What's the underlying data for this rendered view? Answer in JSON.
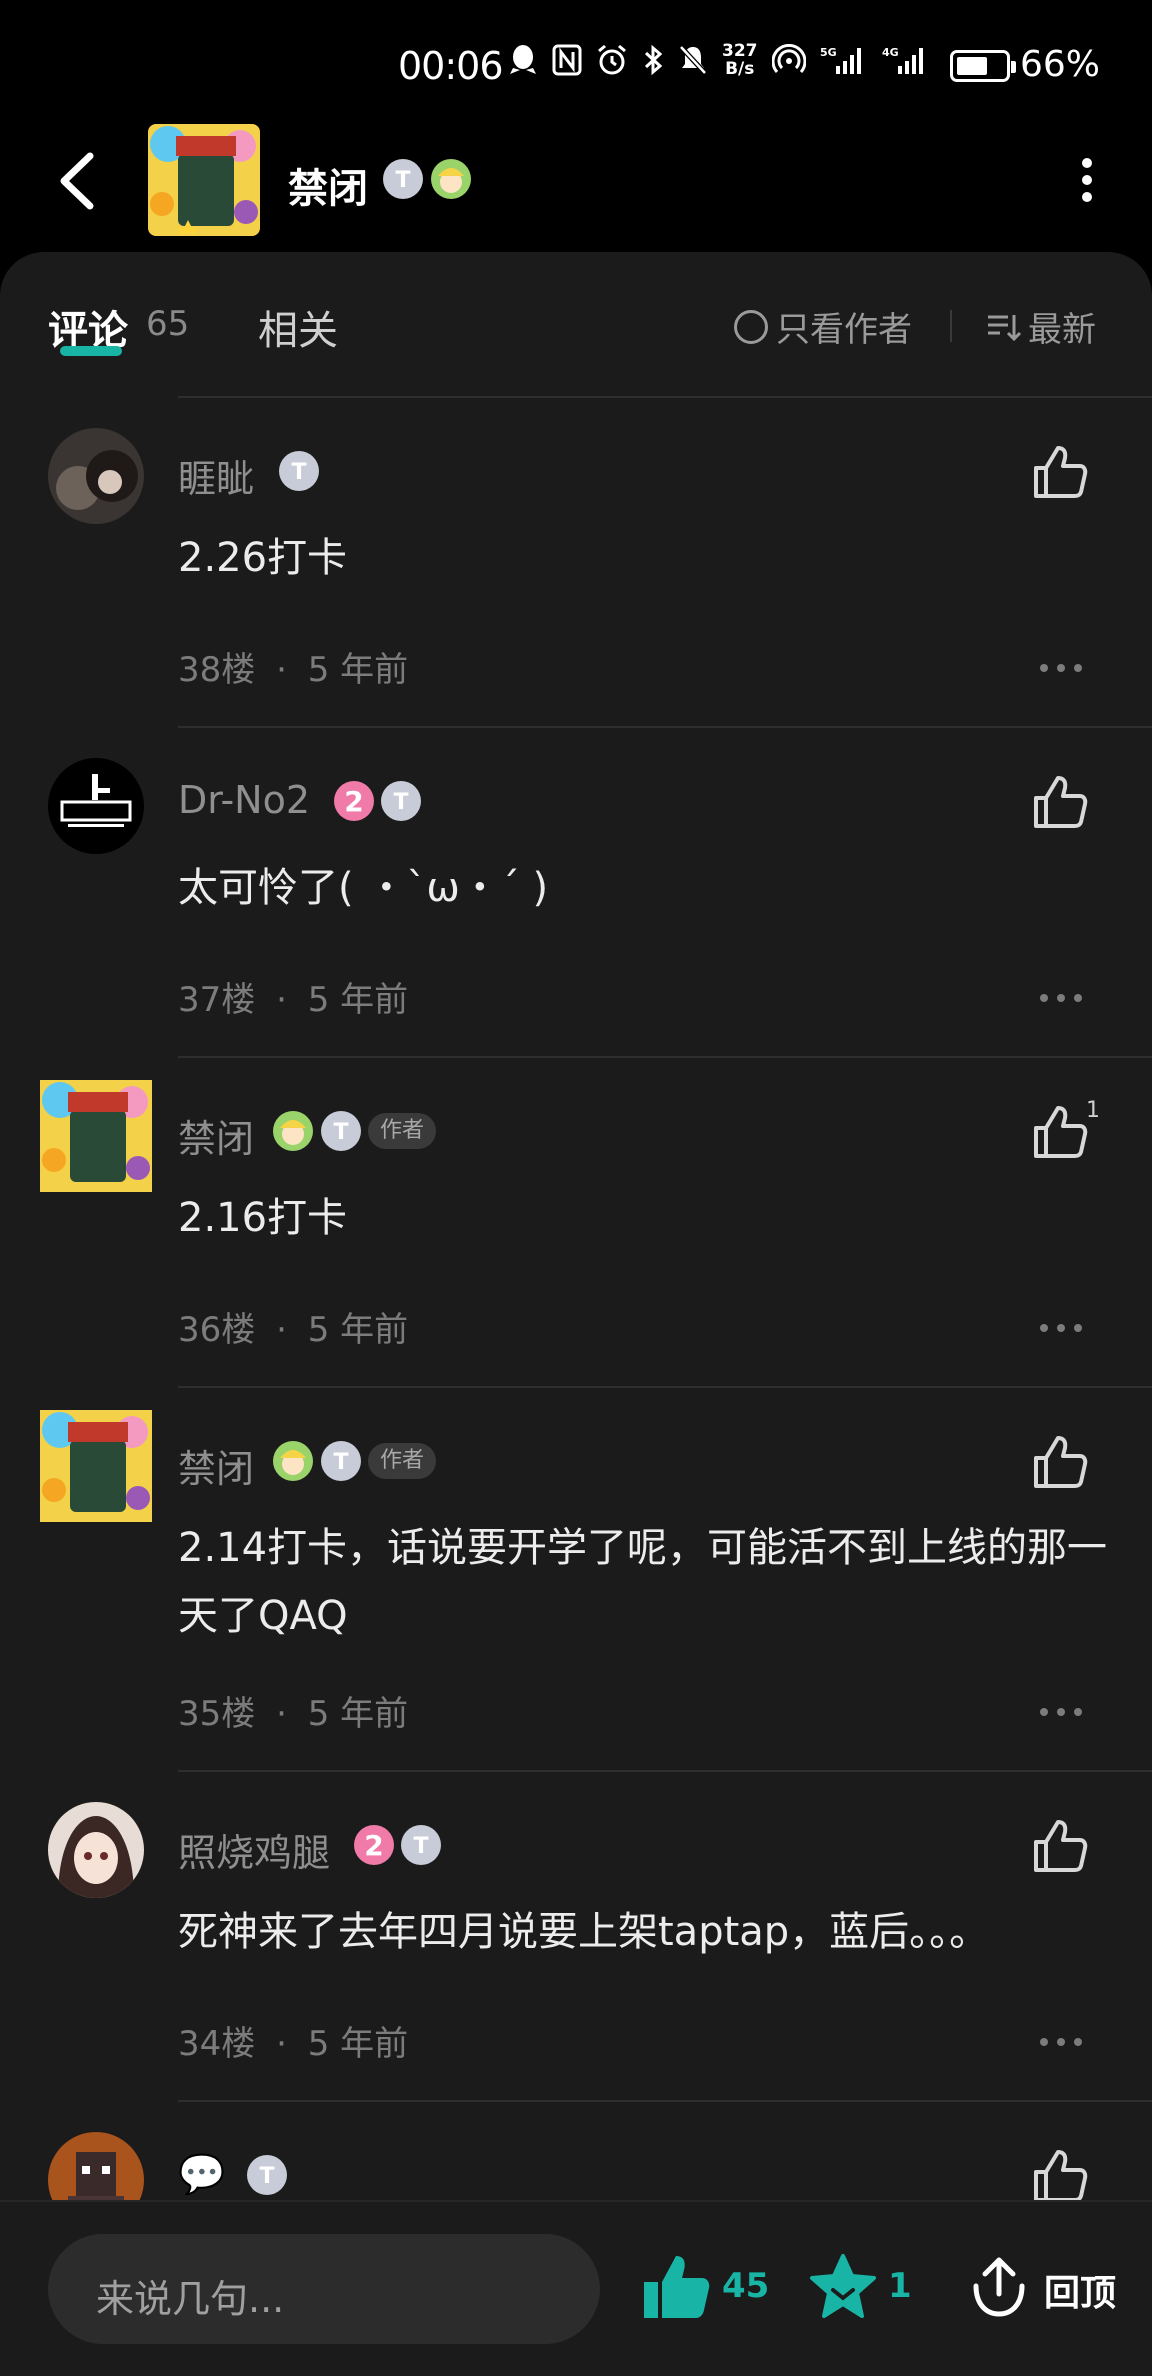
{
  "status": {
    "time": "00:06",
    "net_speed_top": "327",
    "net_speed_bottom": "B/s",
    "battery_percent": "66%",
    "battery_level": 0.66
  },
  "header": {
    "title": "禁闭",
    "icons": [
      "back-arrow-icon",
      "avatar-image",
      "badge-t-icon",
      "badge-character-icon",
      "more-vertical-icon"
    ]
  },
  "tabs": {
    "comments_label": "评论",
    "comments_count": "65",
    "related_label": "相关",
    "author_only_label": "只看作者",
    "sort_label": "最新"
  },
  "comments": [
    {
      "user": "睚眦",
      "text": "2.26打卡",
      "floor": "38楼",
      "time": "5 年前",
      "likes": ""
    },
    {
      "user": "Dr-No2",
      "text": "太可怜了( ・`ω・´ )",
      "floor": "37楼",
      "time": "5 年前",
      "likes": "",
      "level": "2"
    },
    {
      "user": "禁闭",
      "text": "2.16打卡",
      "floor": "36楼",
      "time": "5 年前",
      "likes": "1",
      "author_badge": "作者"
    },
    {
      "user": "禁闭",
      "text": "2.14打卡，话说要开学了呢，可能活不到上线的那一天了QAQ",
      "floor": "35楼",
      "time": "5 年前",
      "likes": "",
      "author_badge": "作者"
    },
    {
      "user": "照烧鸡腿",
      "text": "死神来了去年四月说要上架taptap，蓝后。。。",
      "floor": "34楼",
      "time": "5 年前",
      "likes": "",
      "level": "2"
    },
    {
      "user": "💬",
      "text": "",
      "floor": "",
      "time": "",
      "likes": ""
    }
  ],
  "meta_separator": "·",
  "bottom": {
    "input_placeholder": "来说几句...",
    "like_count": "45",
    "fav_count": "1",
    "back_top_label": "回顶"
  },
  "colors": {
    "accent": "#18b5a6",
    "background": "#1b1b1b",
    "pink_level": "#f07aa8"
  }
}
